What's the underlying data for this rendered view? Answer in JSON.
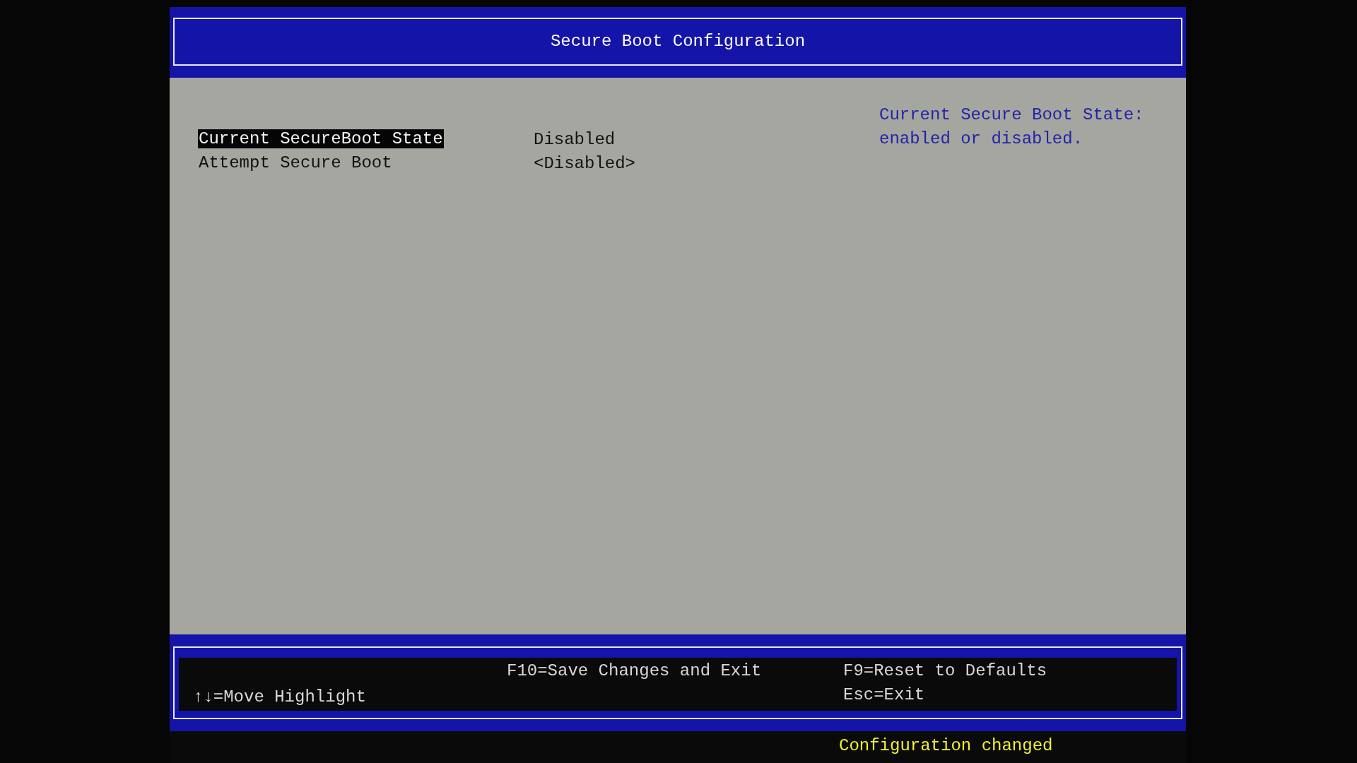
{
  "title": "Secure Boot Configuration",
  "menu_items": [
    {
      "label": "Current SecureBoot State",
      "value": "Disabled",
      "selected": true
    },
    {
      "label": "Attempt Secure Boot",
      "value": "<Disabled>",
      "selected": false
    }
  ],
  "help_text": "Current Secure Boot State: enabled or disabled.",
  "key_hints": [
    {
      "kind": "lower",
      "lines": [
        "↑↓=Move Highlight"
      ]
    },
    {
      "kind": "upper",
      "lines": [
        "F10=Save Changes and Exit"
      ]
    },
    {
      "kind": "upper",
      "lines": [
        "F9=Reset to Defaults",
        "Esc=Exit"
      ]
    }
  ],
  "status_message": "Configuration changed"
}
